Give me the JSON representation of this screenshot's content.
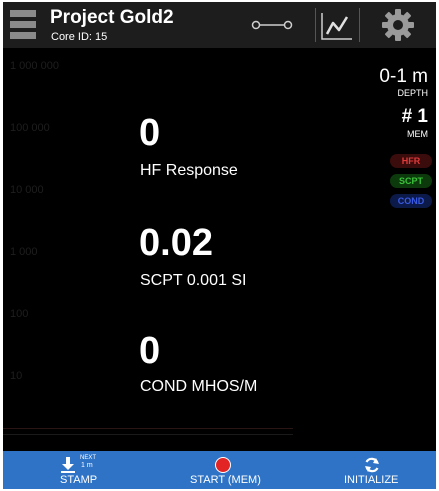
{
  "header": {
    "title": "Project Gold2",
    "subtitle": "Core ID: 15",
    "icons": [
      "menu-icon",
      "connection-icon",
      "chart-icon",
      "gear-icon"
    ]
  },
  "scale": {
    "labels": [
      "1 000 000",
      "100 000",
      "10 000",
      "1 000",
      "100",
      "10"
    ]
  },
  "readings": [
    {
      "value": "0",
      "label": "HF Response"
    },
    {
      "value": "0.02",
      "label": "SCPT 0.001 SI"
    },
    {
      "value": "0",
      "label": "COND MHOS/M"
    }
  ],
  "status": {
    "depth_value": "0-1 m",
    "depth_label": "DEPTH",
    "mem_value": "# 1",
    "mem_label": "MEM"
  },
  "badges": [
    {
      "label": "HFR",
      "color": "#e23a3a",
      "bg": "#3a0c0c"
    },
    {
      "label": "SCPT",
      "color": "#3ac23a",
      "bg": "#0c3a0c"
    },
    {
      "label": "COND",
      "color": "#3a5ae2",
      "bg": "#0c1a4a"
    }
  ],
  "bottom_bar": {
    "stamp_next_label": "NEXT",
    "stamp_next_value": "1 m",
    "stamp_label": "STAMP",
    "start_label": "START (MEM)",
    "initialize_label": "INITIALIZE"
  },
  "colors": {
    "bottom_bar": "#2f73c6",
    "record": "#e32424"
  }
}
